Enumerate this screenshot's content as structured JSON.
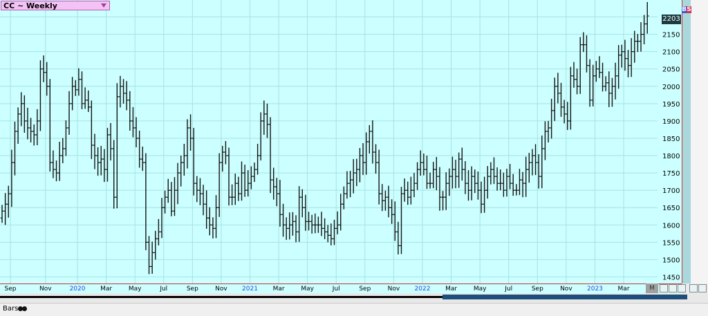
{
  "window": {
    "title": "CC ~ Weekly",
    "price_badge": "2203",
    "buy_label": "B",
    "sell_label": "S",
    "bottom_label": "Bars",
    "x_edge_label": "M"
  },
  "colors": {
    "plot_bg": "#ccffff",
    "grid": "#a6e2e2",
    "bar": "#111111",
    "year_label": "#1a4ee0",
    "price_badge_bg": "#1c3c40",
    "title_bg": "#f4c3f4",
    "red_axis": "#d03030",
    "scroll_thumb": "#1e4e7a"
  },
  "chart_data": {
    "type": "bar",
    "style": "ohlc",
    "title": "CC ~ Weekly",
    "ylim": [
      1435,
      2245
    ],
    "y_ticks": [
      1450,
      1500,
      1550,
      1600,
      1650,
      1700,
      1750,
      1800,
      1850,
      1900,
      1950,
      2000,
      2050,
      2100,
      2150,
      2200
    ],
    "x_ticks": [
      {
        "label": "Sep",
        "i": 0,
        "year": false
      },
      {
        "label": "Nov",
        "i": 11,
        "year": false
      },
      {
        "label": "2020",
        "i": 21,
        "year": true
      },
      {
        "label": "Mar",
        "i": 30,
        "year": false
      },
      {
        "label": "May",
        "i": 39,
        "year": false
      },
      {
        "label": "Jul",
        "i": 48,
        "year": false
      },
      {
        "label": "Sep",
        "i": 57,
        "year": false
      },
      {
        "label": "Nov",
        "i": 66,
        "year": false
      },
      {
        "label": "2021",
        "i": 75,
        "year": true
      },
      {
        "label": "Mar",
        "i": 84,
        "year": false
      },
      {
        "label": "May",
        "i": 93,
        "year": false
      },
      {
        "label": "Jul",
        "i": 102,
        "year": false
      },
      {
        "label": "Sep",
        "i": 111,
        "year": false
      },
      {
        "label": "Nov",
        "i": 120,
        "year": false
      },
      {
        "label": "2022",
        "i": 129,
        "year": true
      },
      {
        "label": "Mar",
        "i": 138,
        "year": false
      },
      {
        "label": "May",
        "i": 147,
        "year": false
      },
      {
        "label": "Jul",
        "i": 156,
        "year": false
      },
      {
        "label": "Sep",
        "i": 165,
        "year": false
      },
      {
        "label": "Nov",
        "i": 174,
        "year": false
      },
      {
        "label": "2023",
        "i": 183,
        "year": true
      },
      {
        "label": "Mar",
        "i": 192,
        "year": false
      }
    ],
    "closes": [
      1640,
      1660,
      1690,
      1780,
      1870,
      1920,
      1950,
      1900,
      1880,
      1870,
      1860,
      1900,
      2050,
      2040,
      2000,
      1780,
      1760,
      1750,
      1800,
      1820,
      1880,
      1950,
      2000,
      1990,
      2020,
      1950,
      1960,
      1940,
      1830,
      1800,
      1780,
      1790,
      1760,
      1860,
      1820,
      1680,
      1970,
      2000,
      1980,
      1960,
      1900,
      1880,
      1850,
      1790,
      1780,
      1550,
      1480,
      1520,
      1560,
      1580,
      1650,
      1680,
      1700,
      1640,
      1700,
      1750,
      1780,
      1800,
      1880,
      1850,
      1720,
      1700,
      1690,
      1660,
      1620,
      1600,
      1590,
      1650,
      1780,
      1810,
      1800,
      1680,
      1680,
      1720,
      1690,
      1750,
      1700,
      1720,
      1740,
      1760,
      1800,
      1900,
      1920,
      1890,
      1730,
      1710,
      1690,
      1630,
      1600,
      1590,
      1600,
      1610,
      1580,
      1680,
      1650,
      1610,
      1610,
      1600,
      1600,
      1600,
      1590,
      1580,
      1570,
      1560,
      1590,
      1600,
      1660,
      1690,
      1720,
      1730,
      1750,
      1760,
      1800,
      1780,
      1840,
      1870,
      1810,
      1780,
      1690,
      1670,
      1680,
      1650,
      1630,
      1580,
      1540,
      1690,
      1700,
      1680,
      1700,
      1720,
      1760,
      1780,
      1760,
      1720,
      1720,
      1760,
      1740,
      1680,
      1680,
      1720,
      1740,
      1760,
      1740,
      1790,
      1760,
      1720,
      1700,
      1740,
      1720,
      1700,
      1660,
      1700,
      1740,
      1760,
      1740,
      1720,
      1720,
      1700,
      1740,
      1720,
      1700,
      1700,
      1730,
      1720,
      1760,
      1780,
      1800,
      1780,
      1740,
      1820,
      1870,
      1880,
      1930,
      2000,
      1980,
      1940,
      1920,
      1900,
      2030,
      2020,
      2000,
      2120,
      2120,
      2060,
      1960,
      2030,
      2050,
      2040,
      2000,
      2010,
      1980,
      2000,
      2030,
      2090,
      2100,
      2080,
      2060,
      2100,
      2130,
      2130,
      2150,
      2180,
      2203
    ]
  }
}
